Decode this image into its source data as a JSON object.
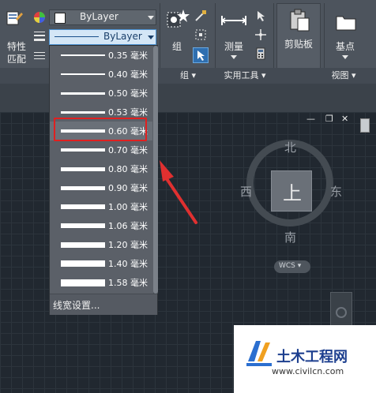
{
  "ribbon": {
    "match_properties_label_line1": "特性",
    "match_properties_label_line2": "匹配",
    "color_value": "ByLayer",
    "lineweight_value": "ByLayer",
    "group_label": "组",
    "group_panel_label": "组 ▾",
    "measure_label": "测量",
    "utilities_panel_label": "实用工具 ▾",
    "clipboard_label": "剪贴板",
    "base_label": "基点",
    "view_panel_label": "视图 ▾"
  },
  "lineweight_options": [
    {
      "label": "0.35 毫米",
      "weight": 0.35
    },
    {
      "label": "0.40 毫米",
      "weight": 0.4
    },
    {
      "label": "0.50 毫米",
      "weight": 0.5
    },
    {
      "label": "0.53 毫米",
      "weight": 0.53
    },
    {
      "label": "0.60 毫米",
      "weight": 0.6
    },
    {
      "label": "0.70 毫米",
      "weight": 0.7
    },
    {
      "label": "0.80 毫米",
      "weight": 0.8
    },
    {
      "label": "0.90 毫米",
      "weight": 0.9
    },
    {
      "label": "1.00 毫米",
      "weight": 1.0
    },
    {
      "label": "1.06 毫米",
      "weight": 1.06
    },
    {
      "label": "1.20 毫米",
      "weight": 1.2
    },
    {
      "label": "1.40 毫米",
      "weight": 1.4
    },
    {
      "label": "1.58 毫米",
      "weight": 1.58
    }
  ],
  "highlighted_option": "0.60 毫米",
  "lineweight_settings_label": "线宽设置...",
  "viewport_controls": {
    "minimize": "—",
    "restore": "❐",
    "close": "✕"
  },
  "viewcube": {
    "north": "北",
    "south": "南",
    "east": "东",
    "west": "西",
    "face": "上",
    "wcs": "WCS ▾"
  },
  "watermark": {
    "title": "土木工程网",
    "url": "www.civilcn.com"
  },
  "colors": {
    "highlight_box": "#e02020",
    "arrow": "#e03030",
    "canvas": "#212830"
  }
}
